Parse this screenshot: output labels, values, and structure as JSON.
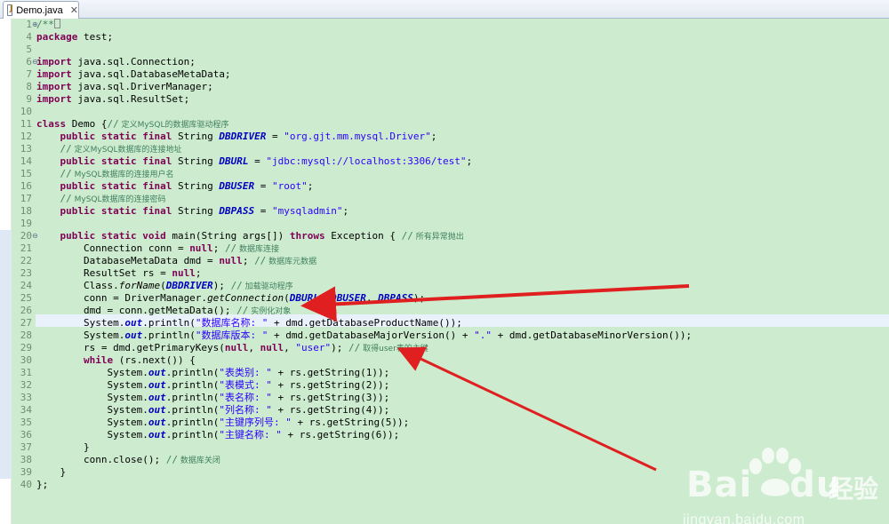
{
  "tab": {
    "title": "Demo.java",
    "close": "✕"
  },
  "icons": {
    "file": "java-file-icon"
  },
  "colors": {
    "editor_bg": "#cdeccf",
    "keyword": "#7f0055",
    "string": "#2a00ff",
    "comment": "#3f7f5f",
    "field": "#0000c0",
    "arrow": "#e02020"
  },
  "lines": [
    {
      "n": "1",
      "fold": "+",
      "code": "/**"
    },
    {
      "n": "4",
      "code": "package test;"
    },
    {
      "n": "5",
      "code": ""
    },
    {
      "n": "6",
      "fold": "-",
      "code": "import java.sql.Connection;"
    },
    {
      "n": "7",
      "code": "import java.sql.DatabaseMetaData;"
    },
    {
      "n": "8",
      "code": "import java.sql.DriverManager;"
    },
    {
      "n": "9",
      "code": "import java.sql.ResultSet;"
    },
    {
      "n": "10",
      "code": ""
    },
    {
      "n": "11",
      "code": "class Demo {// 定义MySQL的数据库驱动程序"
    },
    {
      "n": "12",
      "code": "    public static final String DBDRIVER = \"org.gjt.mm.mysql.Driver\";"
    },
    {
      "n": "13",
      "code": "    // 定义MySQL数据库的连接地址"
    },
    {
      "n": "14",
      "code": "    public static final String DBURL = \"jdbc:mysql://localhost:3306/test\";"
    },
    {
      "n": "15",
      "code": "    // MySQL数据库的连接用户名"
    },
    {
      "n": "16",
      "code": "    public static final String DBUSER = \"root\";"
    },
    {
      "n": "17",
      "code": "    // MySQL数据库的连接密码"
    },
    {
      "n": "18",
      "code": "    public static final String DBPASS = \"mysqladmin\";"
    },
    {
      "n": "19",
      "code": ""
    },
    {
      "n": "20",
      "fold": "-",
      "code": "    public static void main(String args[]) throws Exception { // 所有异常抛出"
    },
    {
      "n": "21",
      "code": "        Connection conn = null; // 数据库连接"
    },
    {
      "n": "22",
      "code": "        DatabaseMetaData dmd = null; // 数据库元数据"
    },
    {
      "n": "23",
      "code": "        ResultSet rs = null;"
    },
    {
      "n": "24",
      "code": "        Class.forName(DBDRIVER); // 加载驱动程序"
    },
    {
      "n": "25",
      "code": "        conn = DriverManager.getConnection(DBURL, DBUSER, DBPASS);"
    },
    {
      "n": "26",
      "code": "        dmd = conn.getMetaData(); // 实例化对象"
    },
    {
      "n": "27",
      "code": "        System.out.println(\"数据库名称: \" + dmd.getDatabaseProductName());"
    },
    {
      "n": "28",
      "code": "        System.out.println(\"数据库版本: \" + dmd.getDatabaseMajorVersion() + \".\" + dmd.getDatabaseMinorVersion());"
    },
    {
      "n": "29",
      "code": "        rs = dmd.getPrimaryKeys(null, null, \"user\"); // 取得user表的主键"
    },
    {
      "n": "30",
      "code": "        while (rs.next()) {"
    },
    {
      "n": "31",
      "code": "            System.out.println(\"表类别: \" + rs.getString(1));"
    },
    {
      "n": "32",
      "code": "            System.out.println(\"表模式: \" + rs.getString(2));"
    },
    {
      "n": "33",
      "code": "            System.out.println(\"表名称: \" + rs.getString(3));"
    },
    {
      "n": "34",
      "code": "            System.out.println(\"列名称: \" + rs.getString(4));"
    },
    {
      "n": "35",
      "code": "            System.out.println(\"主键序列号: \" + rs.getString(5));"
    },
    {
      "n": "36",
      "code": "            System.out.println(\"主键名称: \" + rs.getString(6));"
    },
    {
      "n": "37",
      "code": "        }"
    },
    {
      "n": "38",
      "code": "        conn.close(); // 数据库关闭"
    },
    {
      "n": "39",
      "code": "    }"
    },
    {
      "n": "40",
      "code": "};"
    }
  ],
  "watermark": {
    "brand": "Bai",
    "brand2": "du",
    "cn": "经验",
    "url": "jingyan.baidu.com"
  }
}
